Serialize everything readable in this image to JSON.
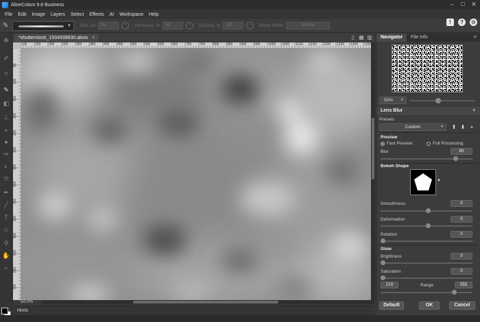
{
  "window": {
    "title": "AliveColors 9.8 Business",
    "minimize": "–",
    "maximize": "□",
    "close": "✕"
  },
  "menubar": [
    "File",
    "Edit",
    "Image",
    "Layers",
    "Select",
    "Effects",
    "AI",
    "Workspace",
    "Help"
  ],
  "options": {
    "size_label": "Size, px",
    "size_value": "55",
    "hardness_label": "Hardness, %",
    "hardness_value": "50",
    "opacity_label": "Opacity, %",
    "opacity_value": "100",
    "blend_label": "Blend Mode",
    "blend_value": "Normal"
  },
  "document": {
    "tab_label": "*shutterstock_1934939630.akvis",
    "close": "×",
    "zoom_readout": "50.0%"
  },
  "ruler": {
    "top_ticks": [
      "100",
      "150",
      "200",
      "250",
      "300",
      "350",
      "400",
      "450",
      "500",
      "550",
      "600",
      "650",
      "700",
      "750",
      "800",
      "850",
      "900",
      "950",
      "1000",
      "1050",
      "1100",
      "1150",
      "1200",
      "1250",
      "1300",
      "1350"
    ],
    "left_ticks": [
      "50",
      "100",
      "150",
      "200",
      "250",
      "300",
      "350",
      "400",
      "450",
      "500",
      "550",
      "600",
      "650",
      "700"
    ]
  },
  "hints": {
    "label": "Hints"
  },
  "navigator": {
    "tab_navigator": "Navigator",
    "tab_fileinfo": "File Info",
    "menu": "≡",
    "zoom_value": "50%"
  },
  "lens_blur": {
    "title": "Lens Blur",
    "presets_label": "Presets",
    "presets_value": "Custom",
    "preview_group": "Preview",
    "fast_preview": "Fast Preview",
    "full_processing": "Full Processing",
    "preview_mode": "Fast Preview",
    "blur_label": "Blur",
    "blur_value": "80",
    "bokeh_group": "Bokeh Shape",
    "smoothness_label": "Smoothness",
    "smoothness_value": "0",
    "deformation_label": "Deformation",
    "deformation_value": "0",
    "rotation_label": "Rotation",
    "rotation_value": "0",
    "glow_group": "Glow",
    "brightness_label": "Brightness",
    "brightness_value": "0",
    "saturation_label": "Saturation",
    "saturation_value": "0",
    "range_label": "Range",
    "range_min": "210",
    "range_max": "255"
  },
  "buttons": {
    "default": "Default",
    "ok": "OK",
    "cancel": "Cancel"
  },
  "icons": {
    "tools": [
      "move-icon",
      "brush-icon",
      "crop-icon",
      "select-icon",
      "eraser-icon",
      "stamp-icon",
      "fill-icon",
      "blur-icon",
      "dropper-icon",
      "lasso-icon",
      "pen-icon",
      "text-icon",
      "shape-icon",
      "hand-icon",
      "zoom-icon"
    ],
    "top_right": [
      "alert-icon",
      "help-icon",
      "settings-icon"
    ]
  },
  "colors": {
    "accent": "#5bb5ff",
    "foreground": "#000000",
    "background": "#ffffff"
  }
}
